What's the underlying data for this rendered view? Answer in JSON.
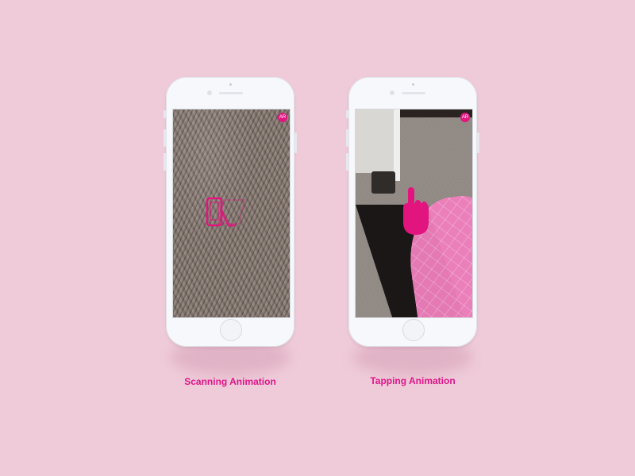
{
  "phones": [
    {
      "caption": "Scanning Animation",
      "screen": "scanning",
      "badge_icon": "ar-badge-icon"
    },
    {
      "caption": "Tapping Animation",
      "screen": "tapping",
      "badge_icon": "ar-badge-icon"
    }
  ],
  "colors": {
    "background": "#efcbd9",
    "accent": "#e2157f",
    "caption": "#e0148a"
  },
  "icons": [
    "scan-phone-icon",
    "tap-hand-icon",
    "ar-badge-icon",
    "home-button-icon"
  ]
}
